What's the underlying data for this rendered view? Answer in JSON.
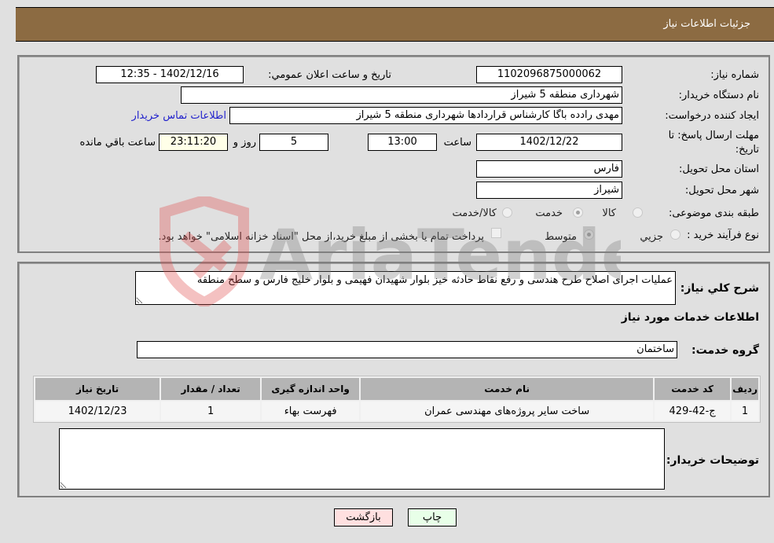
{
  "header": {
    "title": "جزئیات اطلاعات نیاز"
  },
  "details": {
    "need_number": {
      "label": "شماره نیاز:",
      "value": "1102096875000062"
    },
    "announce_datetime": {
      "label": "تاریخ و ساعت اعلان عمومي:",
      "value": "1402/12/16 - 12:35"
    },
    "buyer_org": {
      "label": "نام دستگاه خريدار:",
      "value": "شهرداری منطقه 5 شیراز"
    },
    "requester": {
      "label": "ایجاد کننده درخواست:",
      "value": "مهدی رادده باگا کارشناس قراردادها شهرداری منطقه 5 شیراز"
    },
    "buyer_contact_link": "اطلاعات تماس خریدار",
    "deadline": {
      "label": "مهلت ارسال پاسخ: تا تاریخ:",
      "date": "1402/12/22",
      "time_label": "ساعت",
      "time": "13:00",
      "days": "5",
      "days_label": "روز و",
      "remaining": "23:11:20",
      "remaining_label": "ساعت باقي مانده"
    },
    "province": {
      "label": "استان محل تحویل:",
      "value": "فارس"
    },
    "city": {
      "label": "شهر محل تحویل:",
      "value": "شیراز"
    },
    "category": {
      "label": "طبقه بندی موضوعی:",
      "options": [
        "کالا",
        "خدمت",
        "کالا/خدمت"
      ],
      "selected": "خدمت"
    },
    "purchase_type": {
      "label": "نوع فرآیند خرید :",
      "options": [
        "جزيي",
        "متوسط"
      ],
      "selected": "متوسط",
      "treasury_note": "پرداخت تمام یا بخشی از مبلغ خرید،از محل \"اسناد خزانه اسلامی\" خواهد بود."
    }
  },
  "services": {
    "description_label": "شرح كلي نياز:",
    "description": "عملیات اجرای اصلاح طرح هندسی و رفع نقاط حادثه خیز بلوار شهیدان فهیمی و بلوار خلیج فارس و سطح منطقه",
    "section_title": "اطلاعات خدمات مورد نیاز",
    "group_label": "گروه خدمت:",
    "group_value": "ساختمان",
    "table": {
      "headers": [
        "ردیف",
        "کد خدمت",
        "نام خدمت",
        "واحد اندازه گیری",
        "تعداد / مقدار",
        "تاریخ نیاز"
      ],
      "rows": [
        [
          "1",
          "ج-42-429",
          "ساخت سایر پروژه‌های مهندسی عمران",
          "فهرست بهاء",
          "1",
          "1402/12/23"
        ]
      ]
    },
    "buyer_notes_label": "توضیحات خریدار:",
    "buyer_notes": ""
  },
  "buttons": {
    "print": "چاپ",
    "back": "بازگشت"
  },
  "watermark": {
    "text": "AriaTender.neT"
  }
}
